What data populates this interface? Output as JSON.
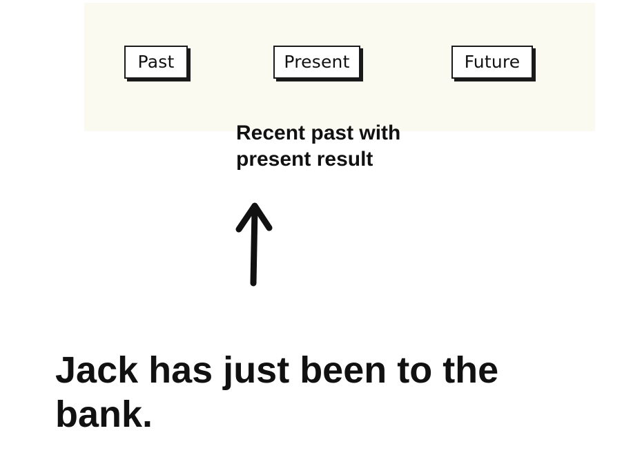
{
  "timeline": {
    "labels": [
      "Past",
      "Present",
      "Future"
    ],
    "background_color": "#fbfaf1",
    "box_border_color": "#1a1a1a"
  },
  "caption": {
    "line1": "Recent past with",
    "line2": "present result"
  },
  "pointer": {
    "icon": "up-arrow-icon",
    "color": "#111111"
  },
  "example": {
    "line1": "Jack has just been to the",
    "line2": "bank."
  }
}
